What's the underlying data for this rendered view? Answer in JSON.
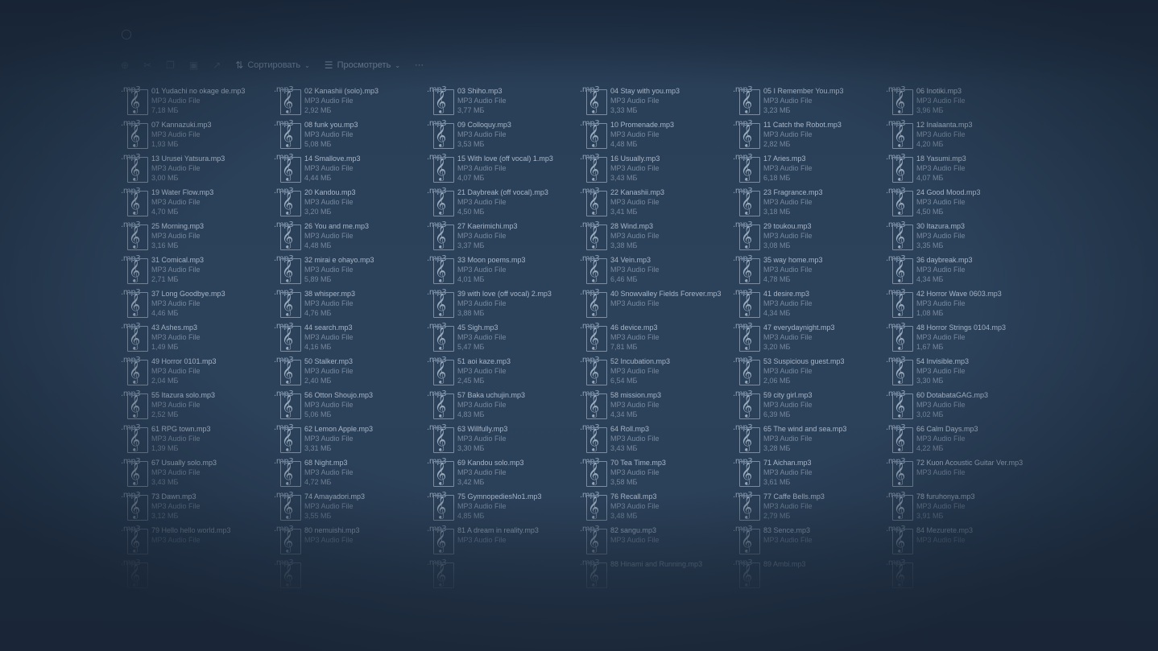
{
  "address": {
    "crumbs": [
      "",
      "",
      "",
      ""
    ],
    "search": ""
  },
  "toolbar": {
    "sort_label": "Сортировать",
    "view_label": "Просмотреть",
    "more_label": "···"
  },
  "icon_ext": ".mp3",
  "files": [
    {
      "name": "01 Yudachi no okage de.mp3",
      "type": "MP3 Audio File",
      "size": "7,18 МБ"
    },
    {
      "name": "02 Kanashii (solo).mp3",
      "type": "MP3 Audio File",
      "size": "2,92 МБ"
    },
    {
      "name": "03 Shiho.mp3",
      "type": "MP3 Audio File",
      "size": "3,77 МБ"
    },
    {
      "name": "04 Stay with you.mp3",
      "type": "MP3 Audio File",
      "size": "3,33 МБ"
    },
    {
      "name": "05 I Remember You.mp3",
      "type": "MP3 Audio File",
      "size": "3,23 МБ"
    },
    {
      "name": "06 Inotiki.mp3",
      "type": "MP3 Audio File",
      "size": "3,96 МБ"
    },
    {
      "name": "07 Kannazuki.mp3",
      "type": "MP3 Audio File",
      "size": "1,93 МБ"
    },
    {
      "name": "08 funk you.mp3",
      "type": "MP3 Audio File",
      "size": "5,08 МБ"
    },
    {
      "name": "09 Colloquy.mp3",
      "type": "MP3 Audio File",
      "size": "3,53 МБ"
    },
    {
      "name": "10 Promenade.mp3",
      "type": "MP3 Audio File",
      "size": "4,48 МБ"
    },
    {
      "name": "11 Catch the Robot.mp3",
      "type": "MP3 Audio File",
      "size": "2,82 МБ"
    },
    {
      "name": "12 Inalaanta.mp3",
      "type": "MP3 Audio File",
      "size": "4,20 МБ"
    },
    {
      "name": "13 Urusei Yatsura.mp3",
      "type": "MP3 Audio File",
      "size": "3,00 МБ"
    },
    {
      "name": "14 Smallove.mp3",
      "type": "MP3 Audio File",
      "size": "4,44 МБ"
    },
    {
      "name": "15 With love (off vocal) 1.mp3",
      "type": "MP3 Audio File",
      "size": "4,07 МБ"
    },
    {
      "name": "16 Usually.mp3",
      "type": "MP3 Audio File",
      "size": "3,43 МБ"
    },
    {
      "name": "17 Aries.mp3",
      "type": "MP3 Audio File",
      "size": "6,18 МБ"
    },
    {
      "name": "18 Yasumi.mp3",
      "type": "MP3 Audio File",
      "size": "4,07 МБ"
    },
    {
      "name": "19 Water Flow.mp3",
      "type": "MP3 Audio File",
      "size": "4,70 МБ"
    },
    {
      "name": "20 Kandou.mp3",
      "type": "MP3 Audio File",
      "size": "3,20 МБ"
    },
    {
      "name": "21 Daybreak (off vocal).mp3",
      "type": "MP3 Audio File",
      "size": "4,50 МБ"
    },
    {
      "name": "22 Kanashii.mp3",
      "type": "MP3 Audio File",
      "size": "3,41 МБ"
    },
    {
      "name": "23 Fragrance.mp3",
      "type": "MP3 Audio File",
      "size": "3,18 МБ"
    },
    {
      "name": "24 Good Mood.mp3",
      "type": "MP3 Audio File",
      "size": "4,50 МБ"
    },
    {
      "name": "25 Morning.mp3",
      "type": "MP3 Audio File",
      "size": "3,16 МБ"
    },
    {
      "name": "26 You and me.mp3",
      "type": "MP3 Audio File",
      "size": "4,48 МБ"
    },
    {
      "name": "27 Kaerimichi.mp3",
      "type": "MP3 Audio File",
      "size": "3,37 МБ"
    },
    {
      "name": "28 Wind.mp3",
      "type": "MP3 Audio File",
      "size": "3,38 МБ"
    },
    {
      "name": "29 toukou.mp3",
      "type": "MP3 Audio File",
      "size": "3,08 МБ"
    },
    {
      "name": "30 Itazura.mp3",
      "type": "MP3 Audio File",
      "size": "3,35 МБ"
    },
    {
      "name": "31 Comical.mp3",
      "type": "MP3 Audio File",
      "size": "2,71 МБ"
    },
    {
      "name": "32 mirai e ohayo.mp3",
      "type": "MP3 Audio File",
      "size": "5,89 МБ"
    },
    {
      "name": "33 Moon poems.mp3",
      "type": "MP3 Audio File",
      "size": "4,01 МБ"
    },
    {
      "name": "34 Vein.mp3",
      "type": "MP3 Audio File",
      "size": "6,46 МБ"
    },
    {
      "name": "35 way home.mp3",
      "type": "MP3 Audio File",
      "size": "4,78 МБ"
    },
    {
      "name": "36 daybreak.mp3",
      "type": "MP3 Audio File",
      "size": "4,34 МБ"
    },
    {
      "name": "37 Long Goodbye.mp3",
      "type": "MP3 Audio File",
      "size": "4,46 МБ"
    },
    {
      "name": "38 whisper.mp3",
      "type": "MP3 Audio File",
      "size": "4,76 МБ"
    },
    {
      "name": "39 with love (off vocal) 2.mp3",
      "type": "MP3 Audio File",
      "size": "3,88 МБ"
    },
    {
      "name": "40 Snowvalley Fields Forever.mp3",
      "type": "MP3 Audio File",
      "size": ""
    },
    {
      "name": "41 desire.mp3",
      "type": "MP3 Audio File",
      "size": "4,34 МБ"
    },
    {
      "name": "42 Horror Wave 0603.mp3",
      "type": "MP3 Audio File",
      "size": "1,08 МБ"
    },
    {
      "name": "43 Ashes.mp3",
      "type": "MP3 Audio File",
      "size": "1,49 МБ"
    },
    {
      "name": "44 search.mp3",
      "type": "MP3 Audio File",
      "size": "4,16 МБ"
    },
    {
      "name": "45 Sigh.mp3",
      "type": "MP3 Audio File",
      "size": "5,47 МБ"
    },
    {
      "name": "46 device.mp3",
      "type": "MP3 Audio File",
      "size": "7,81 МБ"
    },
    {
      "name": "47 everydaynight.mp3",
      "type": "MP3 Audio File",
      "size": "3,20 МБ"
    },
    {
      "name": "48 Horror Strings 0104.mp3",
      "type": "MP3 Audio File",
      "size": "1,67 МБ"
    },
    {
      "name": "49 Horror 0101.mp3",
      "type": "MP3 Audio File",
      "size": "2,04 МБ"
    },
    {
      "name": "50 Stalker.mp3",
      "type": "MP3 Audio File",
      "size": "2,40 МБ"
    },
    {
      "name": "51 aoi kaze.mp3",
      "type": "MP3 Audio File",
      "size": "2,45 МБ"
    },
    {
      "name": "52 Incubation.mp3",
      "type": "MP3 Audio File",
      "size": "6,54 МБ"
    },
    {
      "name": "53 Suspicious guest.mp3",
      "type": "MP3 Audio File",
      "size": "2,06 МБ"
    },
    {
      "name": "54 Invisible.mp3",
      "type": "MP3 Audio File",
      "size": "3,30 МБ"
    },
    {
      "name": "55 Itazura solo.mp3",
      "type": "MP3 Audio File",
      "size": "2,52 МБ"
    },
    {
      "name": "56 Otton Shoujo.mp3",
      "type": "MP3 Audio File",
      "size": "5,06 МБ"
    },
    {
      "name": "57 Baka uchujin.mp3",
      "type": "MP3 Audio File",
      "size": "4,83 МБ"
    },
    {
      "name": "58 mission.mp3",
      "type": "MP3 Audio File",
      "size": "4,34 МБ"
    },
    {
      "name": "59 city girl.mp3",
      "type": "MP3 Audio File",
      "size": "6,39 МБ"
    },
    {
      "name": "60 DotabataGAG.mp3",
      "type": "MP3 Audio File",
      "size": "3,02 МБ"
    },
    {
      "name": "61 RPG town.mp3",
      "type": "MP3 Audio File",
      "size": "1,39 МБ"
    },
    {
      "name": "62 Lemon Apple.mp3",
      "type": "MP3 Audio File",
      "size": "3,31 МБ"
    },
    {
      "name": "63 Willfully.mp3",
      "type": "MP3 Audio File",
      "size": "3,30 МБ"
    },
    {
      "name": "64 Roll.mp3",
      "type": "MP3 Audio File",
      "size": "3,43 МБ"
    },
    {
      "name": "65 The wind and sea.mp3",
      "type": "MP3 Audio File",
      "size": "3,28 МБ"
    },
    {
      "name": "66 Calm Days.mp3",
      "type": "MP3 Audio File",
      "size": "4,22 МБ"
    },
    {
      "name": "67 Usually solo.mp3",
      "type": "MP3 Audio File",
      "size": "3,43 МБ"
    },
    {
      "name": "68 Night.mp3",
      "type": "MP3 Audio File",
      "size": "4,72 МБ"
    },
    {
      "name": "69 Kandou solo.mp3",
      "type": "MP3 Audio File",
      "size": "3,42 МБ"
    },
    {
      "name": "70 Tea Time.mp3",
      "type": "MP3 Audio File",
      "size": "3,58 МБ"
    },
    {
      "name": "71 Aichan.mp3",
      "type": "MP3 Audio File",
      "size": "3,61 МБ"
    },
    {
      "name": "72 Kuon Acoustic Guitar Ver.mp3",
      "type": "MP3 Audio File",
      "size": ""
    },
    {
      "name": "73 Dawn.mp3",
      "type": "MP3 Audio File",
      "size": "3,12 МБ"
    },
    {
      "name": "74 Amayadori.mp3",
      "type": "MP3 Audio File",
      "size": "3,55 МБ"
    },
    {
      "name": "75 GymnopediesNo1.mp3",
      "type": "MP3 Audio File",
      "size": "4,85 МБ"
    },
    {
      "name": "76 Recall.mp3",
      "type": "MP3 Audio File",
      "size": "3,48 МБ"
    },
    {
      "name": "77 Caffe Bells.mp3",
      "type": "MP3 Audio File",
      "size": "2,79 МБ"
    },
    {
      "name": "78 furuhonya.mp3",
      "type": "MP3 Audio File",
      "size": "3,91 МБ"
    },
    {
      "name": "79 Hello hello world.mp3",
      "type": "MP3 Audio File",
      "size": ""
    },
    {
      "name": "80 nemuishi.mp3",
      "type": "MP3 Audio File",
      "size": ""
    },
    {
      "name": "81 A dream in reality.mp3",
      "type": "MP3 Audio File",
      "size": ""
    },
    {
      "name": "82 sangu.mp3",
      "type": "MP3 Audio File",
      "size": ""
    },
    {
      "name": "83 Sence.mp3",
      "type": "MP3 Audio File",
      "size": ""
    },
    {
      "name": "84 Mezurete.mp3",
      "type": "MP3 Audio File",
      "size": ""
    },
    {
      "name": "",
      "type": "",
      "size": ""
    },
    {
      "name": "",
      "type": "",
      "size": ""
    },
    {
      "name": "",
      "type": "",
      "size": ""
    },
    {
      "name": "88 Hinami and Running.mp3",
      "type": "",
      "size": ""
    },
    {
      "name": "89 Ambi.mp3",
      "type": "",
      "size": ""
    },
    {
      "name": "",
      "type": "",
      "size": ""
    }
  ]
}
